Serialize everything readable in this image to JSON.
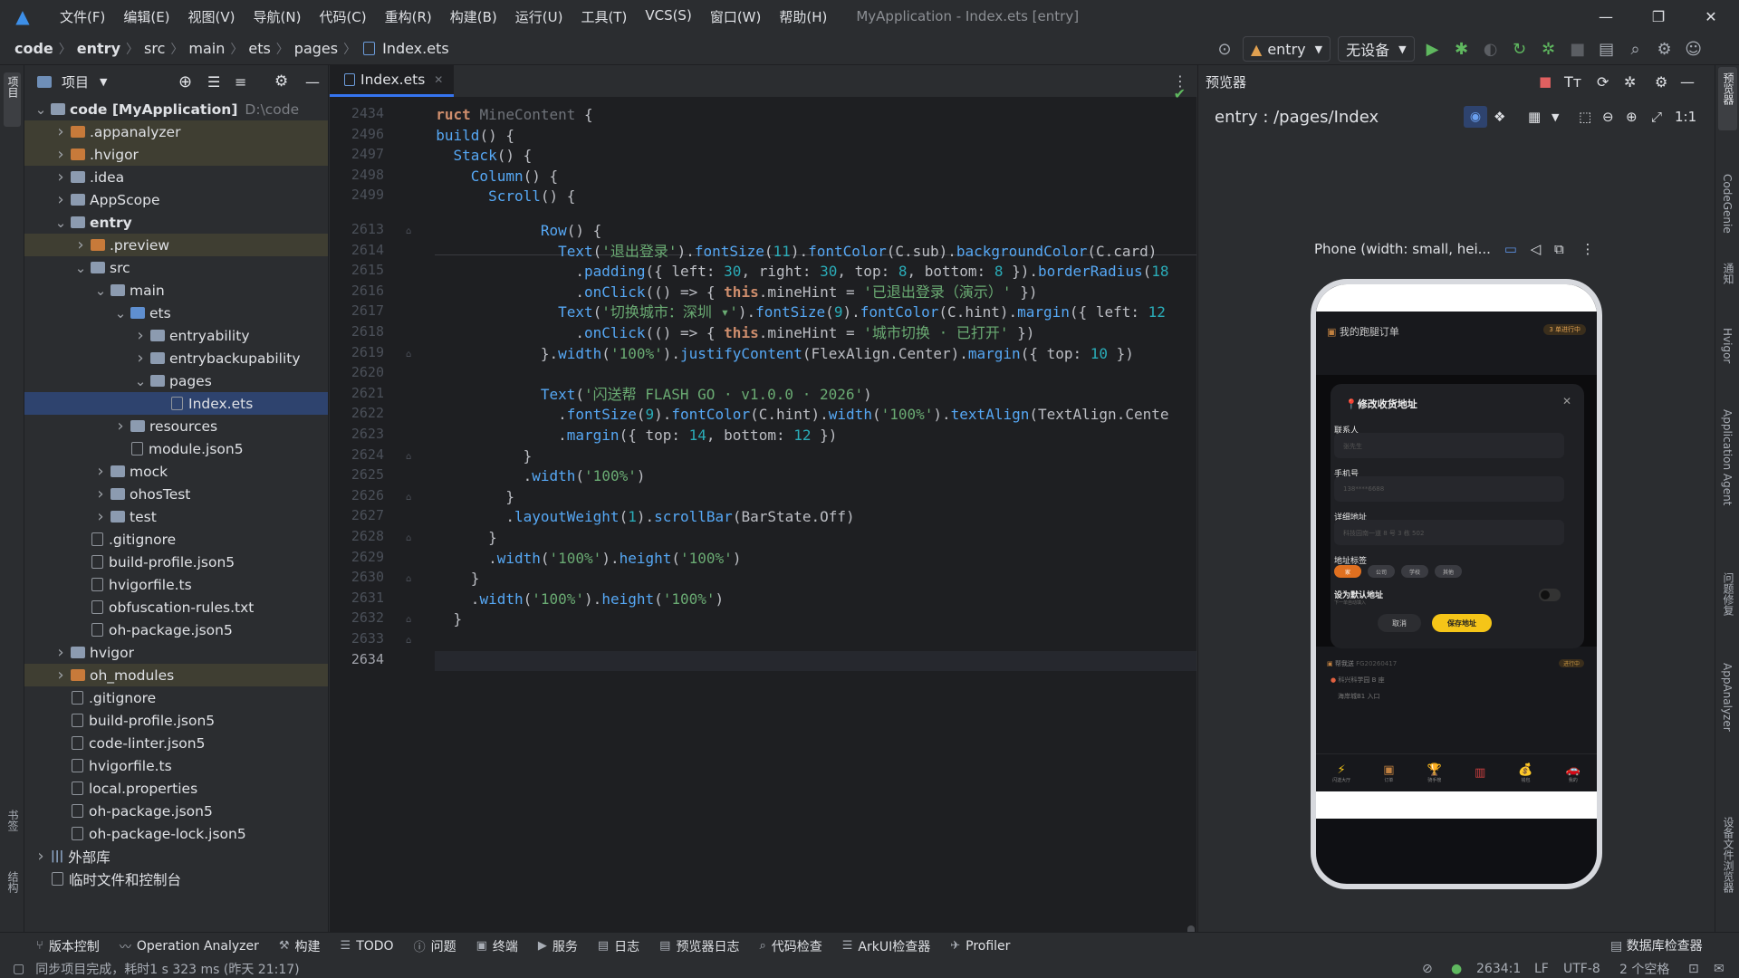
{
  "menubar": {
    "items": [
      "文件(F)",
      "编辑(E)",
      "视图(V)",
      "导航(N)",
      "代码(C)",
      "重构(R)",
      "构建(B)",
      "运行(U)",
      "工具(T)",
      "VCS(S)",
      "窗口(W)",
      "帮助(H)"
    ],
    "title": "MyApplication - Index.ets [entry]"
  },
  "breadcrumb": [
    "code",
    "entry",
    "src",
    "main",
    "ets",
    "pages",
    "Index.ets"
  ],
  "toolbar": {
    "module": "entry",
    "device": "无设备"
  },
  "project": {
    "header": "项目",
    "tree": [
      {
        "label": "code [MyApplication]",
        "extra": "D:\\code",
        "depth": 0,
        "arrow": "open",
        "icon": "folder",
        "hl": false,
        "bold": true
      },
      {
        "label": ".appanalyzer",
        "depth": 1,
        "arrow": "closed",
        "icon": "folder-orange",
        "hl": true
      },
      {
        "label": ".hvigor",
        "depth": 1,
        "arrow": "closed",
        "icon": "folder-orange",
        "hl": true
      },
      {
        "label": ".idea",
        "depth": 1,
        "arrow": "closed",
        "icon": "folder"
      },
      {
        "label": "AppScope",
        "depth": 1,
        "arrow": "closed",
        "icon": "folder"
      },
      {
        "label": "entry",
        "depth": 1,
        "arrow": "open",
        "icon": "folder",
        "bold": true
      },
      {
        "label": ".preview",
        "depth": 2,
        "arrow": "closed",
        "icon": "folder-orange",
        "hl": true
      },
      {
        "label": "src",
        "depth": 2,
        "arrow": "open",
        "icon": "folder"
      },
      {
        "label": "main",
        "depth": 3,
        "arrow": "open",
        "icon": "folder"
      },
      {
        "label": "ets",
        "depth": 4,
        "arrow": "open",
        "icon": "folder-blue"
      },
      {
        "label": "entryability",
        "depth": 5,
        "arrow": "closed",
        "icon": "folder"
      },
      {
        "label": "entrybackupability",
        "depth": 5,
        "arrow": "closed",
        "icon": "folder"
      },
      {
        "label": "pages",
        "depth": 5,
        "arrow": "open",
        "icon": "folder"
      },
      {
        "label": "Index.ets",
        "depth": 6,
        "arrow": "none",
        "icon": "file",
        "sel": true
      },
      {
        "label": "resources",
        "depth": 4,
        "arrow": "closed",
        "icon": "folder"
      },
      {
        "label": "module.json5",
        "depth": 4,
        "arrow": "none",
        "icon": "file"
      },
      {
        "label": "mock",
        "depth": 3,
        "arrow": "closed",
        "icon": "folder"
      },
      {
        "label": "ohosTest",
        "depth": 3,
        "arrow": "closed",
        "icon": "folder"
      },
      {
        "label": "test",
        "depth": 3,
        "arrow": "closed",
        "icon": "folder"
      },
      {
        "label": ".gitignore",
        "depth": 2,
        "arrow": "none",
        "icon": "file"
      },
      {
        "label": "build-profile.json5",
        "depth": 2,
        "arrow": "none",
        "icon": "file"
      },
      {
        "label": "hvigorfile.ts",
        "depth": 2,
        "arrow": "none",
        "icon": "file"
      },
      {
        "label": "obfuscation-rules.txt",
        "depth": 2,
        "arrow": "none",
        "icon": "file"
      },
      {
        "label": "oh-package.json5",
        "depth": 2,
        "arrow": "none",
        "icon": "file"
      },
      {
        "label": "hvigor",
        "depth": 1,
        "arrow": "closed",
        "icon": "folder"
      },
      {
        "label": "oh_modules",
        "depth": 1,
        "arrow": "closed",
        "icon": "folder-orange",
        "hl": true
      },
      {
        "label": ".gitignore",
        "depth": 1,
        "arrow": "none",
        "icon": "file"
      },
      {
        "label": "build-profile.json5",
        "depth": 1,
        "arrow": "none",
        "icon": "file"
      },
      {
        "label": "code-linter.json5",
        "depth": 1,
        "arrow": "none",
        "icon": "file"
      },
      {
        "label": "hvigorfile.ts",
        "depth": 1,
        "arrow": "none",
        "icon": "file"
      },
      {
        "label": "local.properties",
        "depth": 1,
        "arrow": "none",
        "icon": "file"
      },
      {
        "label": "oh-package.json5",
        "depth": 1,
        "arrow": "none",
        "icon": "file"
      },
      {
        "label": "oh-package-lock.json5",
        "depth": 1,
        "arrow": "none",
        "icon": "file"
      },
      {
        "label": "外部库",
        "depth": 0,
        "arrow": "closed",
        "icon": "lib"
      },
      {
        "label": "临时文件和控制台",
        "depth": 0,
        "arrow": "none",
        "icon": "file"
      }
    ]
  },
  "editor": {
    "tab": "Index.ets",
    "sticky_lines": [
      {
        "n": "2434",
        "html": "<span class='kw'>struct</span> <span style='color:#6f737a'>MineContent</span> {"
      },
      {
        "n": "2496",
        "html": "  <span class='fn'>build</span>() {"
      },
      {
        "n": "2497",
        "html": "    <span class='fn'>Stack</span>() {"
      },
      {
        "n": "2498",
        "html": "      <span class='fn'>Column</span>() {"
      },
      {
        "n": "2499",
        "html": "        <span class='fn'>Scroll</span>() {"
      }
    ],
    "lines": [
      {
        "n": "2613",
        "html": "              <span class='fn'>Row</span>() {"
      },
      {
        "n": "2614",
        "html": "                <span class='fn'>Text</span>(<span class='str'>'退出登录'</span>).<span class='fn'>fontSize</span>(<span class='num'>11</span>).<span class='fn'>fontColor</span>(C.sub).<span class='fn'>backgroundColor</span>(C.card)"
      },
      {
        "n": "2615",
        "html": "                  .<span class='fn'>padding</span>({ left: <span class='num'>30</span>, right: <span class='num'>30</span>, top: <span class='num'>8</span>, bottom: <span class='num'>8</span> }).<span class='fn'>borderRadius</span>(<span class='num'>18</span>"
      },
      {
        "n": "2616",
        "html": "                  .<span class='fn'>onClick</span>(() => { <span class='kw'>this</span>.mineHint = <span class='str'>'已退出登录（演示）'</span> })"
      },
      {
        "n": "2617",
        "html": "                <span class='fn'>Text</span>(<span class='str'>'切换城市：深圳 ▾'</span>).<span class='fn'>fontSize</span>(<span class='num'>9</span>).<span class='fn'>fontColor</span>(C.hint).<span class='fn'>margin</span>({ left: <span class='num'>12</span>"
      },
      {
        "n": "2618",
        "html": "                  .<span class='fn'>onClick</span>(() => { <span class='kw'>this</span>.mineHint = <span class='str'>'城市切换 · 已打开'</span> })"
      },
      {
        "n": "2619",
        "html": "              }.<span class='fn'>width</span>(<span class='str'>'100%'</span>).<span class='fn'>justifyContent</span>(FlexAlign.Center).<span class='fn'>margin</span>({ top: <span class='num'>10</span> })"
      },
      {
        "n": "2620",
        "html": ""
      },
      {
        "n": "2621",
        "html": "              <span class='fn'>Text</span>(<span class='str'>'闪送帮 FLASH GO · v1.0.0 · 2026'</span>)"
      },
      {
        "n": "2622",
        "html": "                .<span class='fn'>fontSize</span>(<span class='num'>9</span>).<span class='fn'>fontColor</span>(C.hint).<span class='fn'>width</span>(<span class='str'>'100%'</span>).<span class='fn'>textAlign</span>(TextAlign.Cente"
      },
      {
        "n": "2623",
        "html": "                .<span class='fn'>margin</span>({ top: <span class='num'>14</span>, bottom: <span class='num'>12</span> })"
      },
      {
        "n": "2624",
        "html": "            }"
      },
      {
        "n": "2625",
        "html": "            .<span class='fn'>width</span>(<span class='str'>'100%'</span>)"
      },
      {
        "n": "2626",
        "html": "          }"
      },
      {
        "n": "2627",
        "html": "          .<span class='fn'>layoutWeight</span>(<span class='num'>1</span>).<span class='fn'>scrollBar</span>(BarState.Off)"
      },
      {
        "n": "2628",
        "html": "        }"
      },
      {
        "n": "2629",
        "html": "        .<span class='fn'>width</span>(<span class='str'>'100%'</span>).<span class='fn'>height</span>(<span class='str'>'100%'</span>)"
      },
      {
        "n": "2630",
        "html": "      }"
      },
      {
        "n": "2631",
        "html": "      .<span class='fn'>width</span>(<span class='str'>'100%'</span>).<span class='fn'>height</span>(<span class='str'>'100%'</span>)"
      },
      {
        "n": "2632",
        "html": "    }"
      },
      {
        "n": "2633",
        "html": "}"
      },
      {
        "n": "2634",
        "html": ""
      }
    ],
    "current_line": "2634"
  },
  "preview": {
    "title": "预览器",
    "route": "entry : /pages/Index",
    "device": "Phone (width: small, hei...",
    "app": {
      "header": "我的跑腿订单",
      "header_badge": "3 单进行中",
      "dialog": {
        "title": "修改收货地址",
        "contact_label": "联系人",
        "contact_ph": "张先生",
        "phone_label": "手机号",
        "phone_ph": "138****6688",
        "addr_label": "详细地址",
        "addr_ph": "科技园南一道 8 号 3 栋 502",
        "tag_label": "地址标签",
        "tags": [
          "家",
          "公司",
          "学校",
          "其他"
        ],
        "default_label": "设为默认地址",
        "default_sub": "下一单自动填入",
        "cancel": "取消",
        "save": "保存地址"
      },
      "order": {
        "name": "帮我送",
        "code": "FG20260417",
        "status": "进行中",
        "from": "科兴科学园 B 座",
        "to": "海岸城B1 入口"
      },
      "nav": [
        "闪送大厅",
        "订单",
        "骑手榜",
        "钱包",
        "我的"
      ]
    }
  },
  "bottom_tools": [
    "版本控制",
    "Operation Analyzer",
    "构建",
    "TODO",
    "问题",
    "终端",
    "服务",
    "日志",
    "预览器日志",
    "代码检查",
    "ArkUI检查器",
    "Profiler"
  ],
  "db_inspector": "数据库检查器",
  "status": {
    "message": "同步项目完成，耗时1 s 323 ms (昨天 21:17)",
    "position": "2634:1",
    "line_sep": "LF",
    "encoding": "UTF-8",
    "indent": "2 个空格"
  },
  "side_labels": {
    "left": [
      "项目",
      "书签",
      "结构"
    ],
    "right": [
      "预览器",
      "CodeGenie",
      "通知",
      "Hvigor",
      "Application Agent",
      "问题修复",
      "AppAnalyzer",
      "设备文件浏览器"
    ]
  }
}
